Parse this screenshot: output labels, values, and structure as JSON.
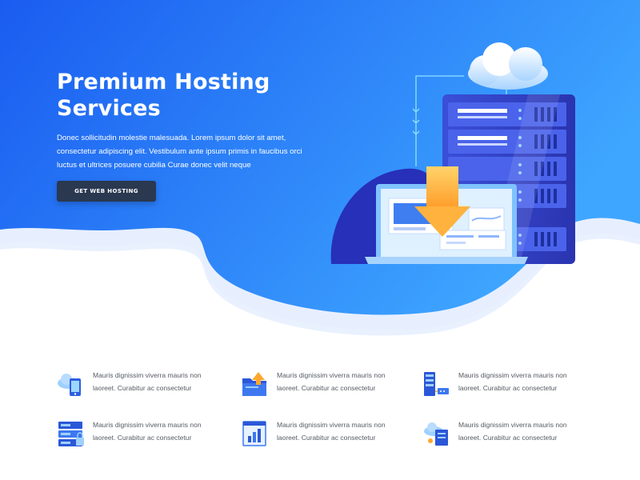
{
  "hero": {
    "title_line1": "Premium Hosting",
    "title_line2": "Services",
    "description": "Donec sollicitudin molestie malesuada. Lorem ipsum dolor sit amet, consectetur adipiscing elit. Vestibulum ante ipsum primis in faucibus orci luctus et ultrices posuere cubilia Curae donec velit neque",
    "cta_label": "GET WEB HOSTING"
  },
  "features": [
    {
      "icon": "cloud-mobile-icon",
      "text": "Mauris dignissim viverra mauris non laoreet. Curabitur ac consectetur"
    },
    {
      "icon": "folder-upload-icon",
      "text": "Mauris dignissim viverra mauris non laoreet. Curabitur ac consectetur"
    },
    {
      "icon": "server-network-icon",
      "text": "Mauris dignissim viverra mauris non laoreet. Curabitur ac consectetur"
    },
    {
      "icon": "server-lock-icon",
      "text": "Mauris dignissim viverra mauris non laoreet. Curabitur ac consectetur"
    },
    {
      "icon": "analytics-chart-icon",
      "text": "Mauris dignissim viverra mauris non laoreet. Curabitur ac consectetur"
    },
    {
      "icon": "cloud-document-icon",
      "text": "Mauris dignissim viverra mauris non laoreet. Curabitur ac consectetur"
    }
  ],
  "colors": {
    "hero_start": "#1a5cf0",
    "hero_end": "#3a9bff",
    "button": "#2a3850",
    "text_muted": "#555a63"
  }
}
